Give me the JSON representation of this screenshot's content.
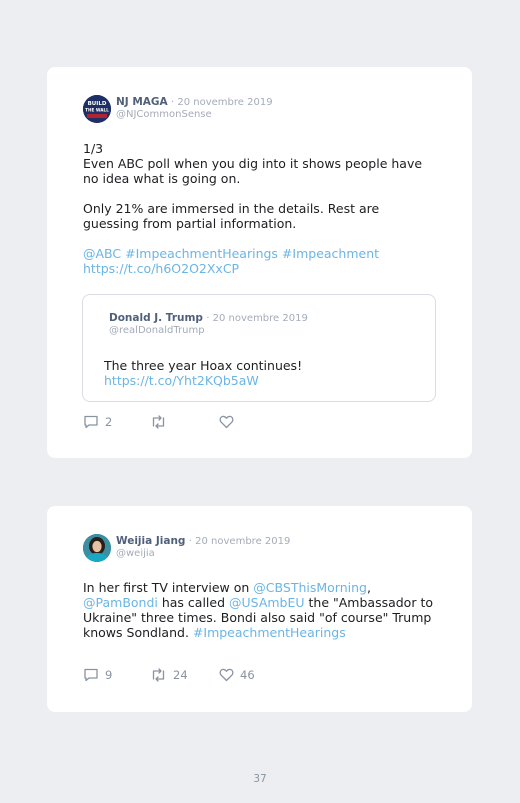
{
  "tweet1": {
    "author_name": "NJ MAGA",
    "date": "· 20 novembre 2019",
    "handle": "@NJCommonSense",
    "avatar_text": [
      "BUILD",
      "THE WALL"
    ],
    "body_line1": "1/3",
    "body_line2": "Even ABC poll when you dig into it shows people have no idea what is going on.",
    "body_para2": "Only 21% are immersed in the details. Rest are guessing from partial information.",
    "hashtags_line": "@ABC #ImpeachmentHearings #Impeachment",
    "link": "https://t.co/h6O2O2XxCP",
    "quoted": {
      "author_name": "Donald J. Trump",
      "date": "· 20 novembre 2019",
      "handle": "@realDonaldTrump",
      "body": "The three year Hoax continues!",
      "link": "https://t.co/Yht2KQb5aW"
    },
    "reply_count": "2",
    "retweet_count": "",
    "like_count": ""
  },
  "tweet2": {
    "author_name": "Weijia Jiang",
    "date": "· 20 novembre 2019",
    "handle": "@weijia",
    "body_part1": "In her first TV interview on ",
    "mention1": "@CBSThisMorning",
    "body_part2": ", ",
    "mention2": "@PamBondi",
    "body_part3": " has called ",
    "mention3": "@USAmbEU",
    "body_part4": " the \"Ambassador to Ukraine\" three times. Bondi also said \"of course\" Trump knows Sondland. ",
    "hashtag": "#ImpeachmentHearings",
    "reply_count": "9",
    "retweet_count": "24",
    "like_count": "46"
  },
  "page_number": "37",
  "colors": {
    "link": "#6bb5e6",
    "name": "#50607a",
    "muted": "#a4acb8",
    "background": "#eceef1"
  }
}
